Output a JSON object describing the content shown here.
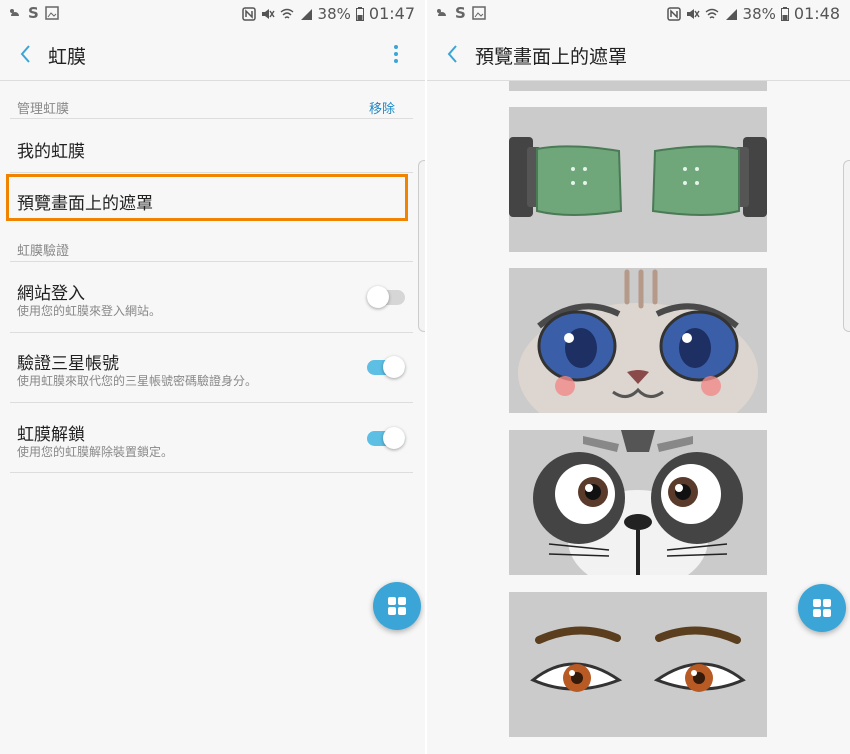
{
  "left": {
    "status": {
      "battery": "38%",
      "time": "01:47"
    },
    "appbar": {
      "title": "虹膜"
    },
    "manage_section": {
      "label": "管理虹膜",
      "action": "移除"
    },
    "my_iris": "我的虹膜",
    "preview_mask": "預覽畫面上的遮罩",
    "verify_section": {
      "label": "虹膜驗證"
    },
    "items": [
      {
        "title": "網站登入",
        "subtitle": "使用您的虹膜來登入網站。",
        "toggle": "off"
      },
      {
        "title": "驗證三星帳號",
        "subtitle": "使用虹膜來取代您的三星帳號密碼驗證身分。",
        "toggle": "on"
      },
      {
        "title": "虹膜解鎖",
        "subtitle": "使用您的虹膜解除裝置鎖定。",
        "toggle": "on"
      }
    ]
  },
  "right": {
    "status": {
      "battery": "38%",
      "time": "01:48"
    },
    "appbar": {
      "title": "預覽畫面上的遮罩"
    },
    "masks": [
      "goggles-mask",
      "owl-cat-mask",
      "raccoon-mask",
      "human-eyes-mask"
    ]
  },
  "colors": {
    "accent": "#3aa5d6",
    "highlight": "#f08300",
    "toggle_on": "#5cbfe3"
  }
}
